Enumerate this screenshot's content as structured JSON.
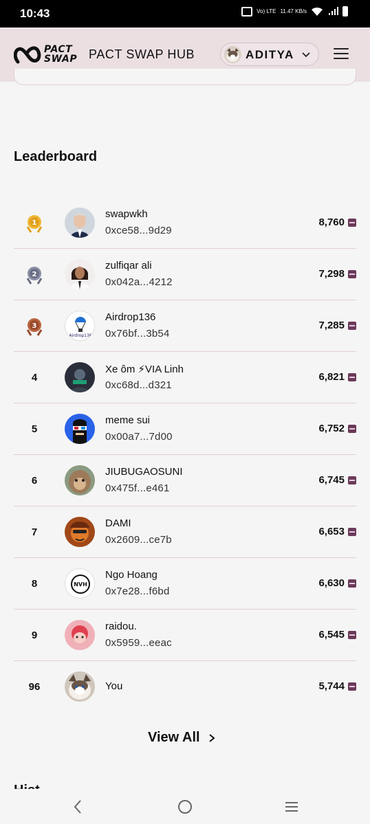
{
  "status_bar": {
    "time": "10:43",
    "network": "Vo) LTE",
    "speed": "11.47 KB/s"
  },
  "header": {
    "logo_text_line1": "PACT",
    "logo_text_line2": "SWAP",
    "title": "PACT SWAP HUB",
    "user_name": "ADITYA"
  },
  "leaderboard": {
    "title": "Leaderboard",
    "rows": [
      {
        "rank": "1",
        "name": "swapwkh",
        "address": "0xce58...9d29",
        "score": "8,760"
      },
      {
        "rank": "2",
        "name": "zulfiqar ali",
        "address": "0x042a...4212",
        "score": "7,298"
      },
      {
        "rank": "3",
        "name": "Airdrop136",
        "address": "0x76bf...3b54",
        "score": "7,285",
        "avatar_text": "Airdrop136"
      },
      {
        "rank": "4",
        "name": "Xe ôm ⚡VIA Linh",
        "address": "0xc68d...d321",
        "score": "6,821"
      },
      {
        "rank": "5",
        "name": "meme sui",
        "address": "0x00a7...7d00",
        "score": "6,752"
      },
      {
        "rank": "6",
        "name": "JIUBUGAOSUNI",
        "address": "0x475f...e461",
        "score": "6,745"
      },
      {
        "rank": "7",
        "name": "DAMI",
        "address": "0x2609...ce7b",
        "score": "6,653"
      },
      {
        "rank": "8",
        "name": "Ngo Hoang",
        "address": "0x7e28...f6bd",
        "score": "6,630",
        "avatar_text": "NVH"
      },
      {
        "rank": "9",
        "name": "raidou.",
        "address": "0x5959...eeac",
        "score": "6,545"
      },
      {
        "rank": "96",
        "name": "You",
        "address": "",
        "score": "5,744"
      }
    ],
    "view_all_label": "View All"
  },
  "next_section_title": "Hist",
  "colors": {
    "header_bg": "#ebdfe2",
    "divider": "#e3cdd4",
    "gold": "#e0a020",
    "silver": "#6a6f86",
    "bronze": "#9a4a2a",
    "token_icon": "#6b3a5a"
  },
  "icons": {
    "menu": "hamburger-icon",
    "chevron": "chevron-down-icon",
    "view_all": "chevron-right-icon",
    "nav_back": "back-icon",
    "nav_home": "home-icon",
    "nav_recent": "recent-apps-icon"
  }
}
